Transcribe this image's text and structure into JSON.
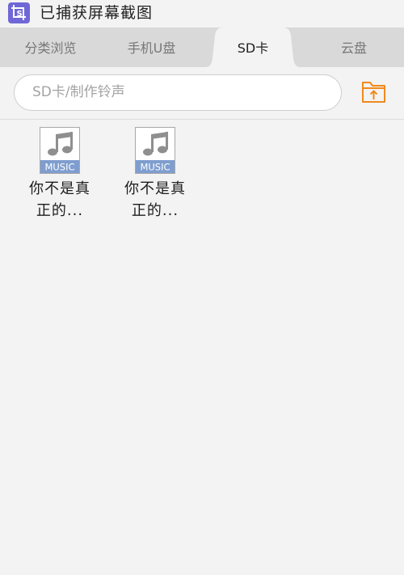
{
  "status_bar": {
    "notification_text": "已捕获屏幕截图",
    "icon": "screenshot-icon"
  },
  "tabs": [
    {
      "label": "分类浏览",
      "active": false
    },
    {
      "label": "手机U盘",
      "active": false
    },
    {
      "label": "SD卡",
      "active": true
    },
    {
      "label": "云盘",
      "active": false
    }
  ],
  "search": {
    "path": "SD卡/制作铃声",
    "upload_icon": "folder-up-icon"
  },
  "files": [
    {
      "name_line1": "你不是真",
      "name_line2": "正的...",
      "icon": "music-file-icon",
      "icon_label": "MUSIC"
    },
    {
      "name_line1": "你不是真",
      "name_line2": "正的...",
      "icon": "music-file-icon",
      "icon_label": "MUSIC"
    }
  ],
  "colors": {
    "accent": "#f08a1c",
    "status_icon": "#6f67d6",
    "tab_bar": "#d9d9d9",
    "background": "#f3f3f3",
    "music_label": "#7f9ecf"
  }
}
